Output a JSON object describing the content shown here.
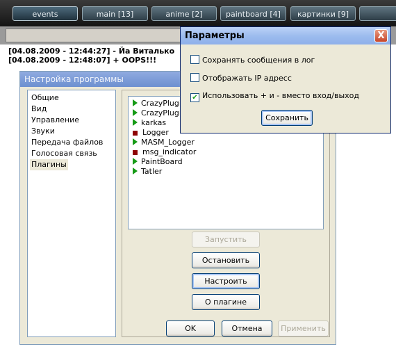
{
  "tabs": [
    {
      "label": "events",
      "active": true
    },
    {
      "label": "main [13]",
      "active": false
    },
    {
      "label": "anime [2]",
      "active": false
    },
    {
      "label": "paintboard [4]",
      "active": false
    },
    {
      "label": "картинки [9]",
      "active": false
    }
  ],
  "chat": {
    "lines": [
      "[04.08.2009 - 12:44:27] - Йа Виталько",
      "[04.08.2009 - 12:48:07] + OOPS!!!"
    ]
  },
  "settings": {
    "title": "Настройка программы",
    "categories": [
      "Общие",
      "Вид",
      "Управление",
      "Звуки",
      "Передача файлов",
      "Голосовая связь",
      "Плагины"
    ],
    "selected_category": "Плагины",
    "plugins": [
      {
        "name": "CrazyPlugin",
        "state": "running"
      },
      {
        "name": "CrazyPlugin",
        "state": "running"
      },
      {
        "name": "karkas",
        "state": "running"
      },
      {
        "name": "Logger",
        "state": "stopped"
      },
      {
        "name": "MASM_Logger",
        "state": "running"
      },
      {
        "name": "msg_indicator",
        "state": "stopped"
      },
      {
        "name": "PaintBoard",
        "state": "running"
      },
      {
        "name": "Tatler",
        "state": "running"
      }
    ],
    "buttons": {
      "start": "Запустить",
      "stop": "Остановить",
      "configure": "Настроить",
      "about": "О плагине",
      "ok": "OK",
      "cancel": "Отмена",
      "apply": "Применить"
    }
  },
  "params": {
    "title": "Параметры",
    "close_glyph": "X",
    "options": [
      {
        "label": "Сохранять сообщения в лог",
        "checked": false
      },
      {
        "label": "Отображать IP адресс",
        "checked": false
      },
      {
        "label": "Использовать + и - вместо вход/выход",
        "checked": true
      }
    ],
    "save_label": "Сохранить",
    "check_glyph": "✔"
  }
}
